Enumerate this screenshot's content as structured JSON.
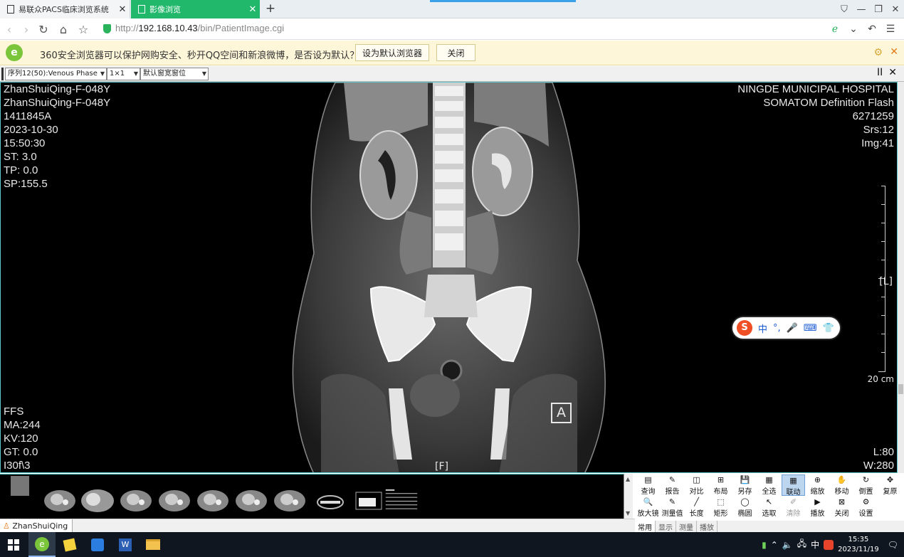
{
  "browser": {
    "tabs": [
      {
        "label": "易联众PACS临床浏览系统",
        "active": false
      },
      {
        "label": "影像浏览",
        "active": true
      }
    ],
    "new_tab": "+",
    "window_controls": [
      "⛉",
      "—",
      "❐",
      "✕"
    ],
    "url_prefix": "http://",
    "url_host": "192.168.10.43",
    "url_path": "/bin/PatientImage.cgi",
    "accent": "#22b86c"
  },
  "notification": {
    "logo": "e",
    "message": "360安全浏览器可以保护网购安全、秒开QQ空间和新浪微博，是否设为默认？",
    "set_default_label": "设为默认浏览器",
    "close_label": "关闭"
  },
  "viewer_toolbar": {
    "series_select": "序列12(50):Venous Phase",
    "layout_select": "1×1",
    "window_select": "默认窗宽窗位",
    "pause_icon": "II",
    "close_icon": "✕"
  },
  "overlay": {
    "top_left": [
      "ZhanShuiQing-F-048Y",
      "ZhanShuiQing-F-048Y",
      "1411845A",
      "2023-10-30",
      "15:50:30",
      "ST:  3.0",
      "TP:  0.0",
      "SP:155.5"
    ],
    "top_right": [
      "NINGDE MUNICIPAL HOSPITAL",
      "SOMATOM Definition Flash",
      "6271259",
      "Srs:12",
      "Img:41"
    ],
    "bottom_left": [
      "FFS",
      "MA:244",
      "KV:120",
      "GT:  0.0",
      "I30f\\3"
    ],
    "bottom_right": [
      "L:80",
      "W:280"
    ],
    "side_marker": "[L]",
    "bottom_marker": "[F]",
    "anterior_marker": "A",
    "scale_label": "20 cm"
  },
  "ime": {
    "logo": "S",
    "items": [
      "中",
      "°,",
      "🎤",
      "⌨",
      "👕"
    ]
  },
  "tools": {
    "row1": [
      {
        "icon": "▤",
        "label": "查询"
      },
      {
        "icon": "✎",
        "label": "报告"
      },
      {
        "icon": "◫",
        "label": "对比"
      },
      {
        "icon": "⊞",
        "label": "布局"
      },
      {
        "icon": "💾",
        "label": "另存"
      },
      {
        "icon": "▦",
        "label": "全选"
      },
      {
        "icon": "▦",
        "label": "联动"
      },
      {
        "icon": "⊕",
        "label": "缩放"
      },
      {
        "icon": "✋",
        "label": "移动"
      },
      {
        "icon": "↻",
        "label": "倒置"
      },
      {
        "icon": "✥",
        "label": "复原"
      }
    ],
    "row2": [
      {
        "icon": "🔍",
        "label": "放大镜"
      },
      {
        "icon": "✎",
        "label": "测量值"
      },
      {
        "icon": "╱",
        "label": "长度"
      },
      {
        "icon": "⬚",
        "label": "矩形"
      },
      {
        "icon": "◯",
        "label": "椭圆"
      },
      {
        "icon": "↖",
        "label": "选取"
      },
      {
        "icon": "✐",
        "label": "清除"
      },
      {
        "icon": "▶",
        "label": "播放"
      },
      {
        "icon": "⊠",
        "label": "关闭"
      },
      {
        "icon": "⚙",
        "label": "设置"
      }
    ],
    "tabs": [
      "常用",
      "显示",
      "测量",
      "播放"
    ]
  },
  "status": {
    "patient_tab": "ZhanShuiQing"
  },
  "taskbar": {
    "tray_text": "中",
    "time": "15:35",
    "date": "2023/11/19"
  }
}
